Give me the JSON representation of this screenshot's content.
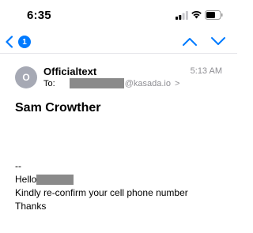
{
  "status_bar": {
    "time": "6:35"
  },
  "nav": {
    "badge_count": "1"
  },
  "message": {
    "avatar_initial": "O",
    "sender": "Officialtext",
    "time": "5:13 AM",
    "to_label": "To:",
    "to_domain": "@kasada.io",
    "to_chevron": ">",
    "subject": "Sam Crowther",
    "body": {
      "separator": "--",
      "greeting": "Hello",
      "line2": "Kindly re-confirm your cell phone number",
      "line3": "Thanks"
    }
  },
  "colors": {
    "accent": "#007aff",
    "avatar": "#a6a9b4",
    "redaction": "#8a8a8a",
    "secondary_text": "#8e8e93"
  }
}
